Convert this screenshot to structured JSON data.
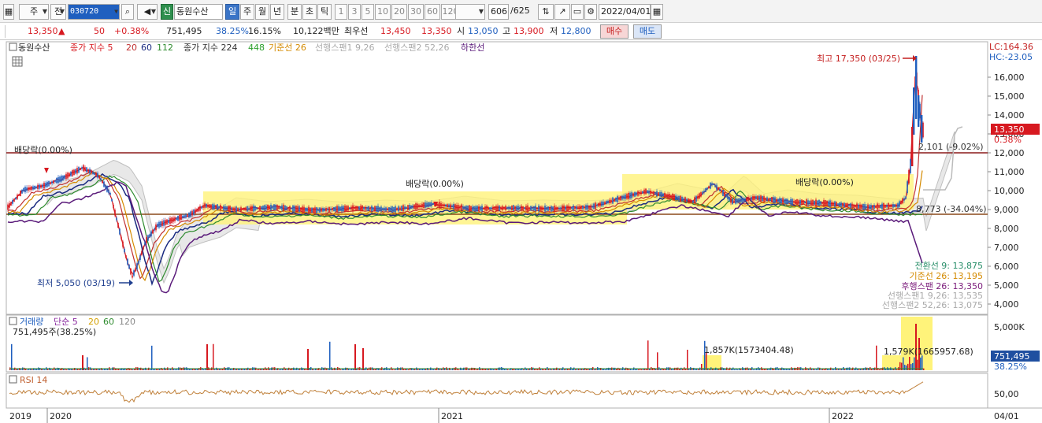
{
  "toolbar": {
    "period": "주",
    "prev": "전",
    "code": "030720",
    "sound_icon": "speaker-icon",
    "new_badge": "신",
    "stock_name": "동원수산",
    "tf_day": "일",
    "tf_week": "주",
    "tf_month": "월",
    "tf_year": "년",
    "tf_min": "분",
    "tf_sec": "초",
    "tf_tick": "틱",
    "intervals": [
      "1",
      "3",
      "5",
      "10",
      "20",
      "30",
      "60",
      "120"
    ],
    "count": "606",
    "total": "/625",
    "date": "2022/04/01"
  },
  "quote": {
    "price": "13,350",
    "arrow": "▲",
    "change": "50",
    "change_pct": "+0.38%",
    "volume": "751,495",
    "vol_ratio": "38.25%",
    "turnover": "16.15%",
    "amount": "10,122백만",
    "best_ask_label": "최우선",
    "best_ask": "13,450",
    "best_bid": "13,350",
    "open_label": "시",
    "open": "13,050",
    "high_label": "고",
    "high": "13,900",
    "low_label": "저",
    "low": "12,800",
    "buy": "매수",
    "sell": "매도"
  },
  "legend": {
    "name": "동원수산",
    "ma_label": "종가 지수 5",
    "ma20": "20",
    "ma60": "60",
    "ma112": "112",
    "ma224_label": "종가 지수 224",
    "ma448": "448",
    "base_line": "기준선 26",
    "span1": "선행스팬1 9,26",
    "span2": "선행스팬2 52,26",
    "lower": "하한선"
  },
  "annotations": {
    "high": "최고 17,350 (03/25)",
    "low": "최저 5,050 (03/19)",
    "div1": "배당락(0.00%)",
    "div2": "배당락(0.00%)",
    "div3": "배당락(0.00%)",
    "hline1": "2,101 (-9.02%)",
    "hline2": "8,773 (-34.04%)",
    "lc": "LC:164.36",
    "hc": "HC:-23.05",
    "cur_price": "13,350",
    "cur_pct": "0.38%"
  },
  "right_legend": {
    "conv": "전환선 9: 13,875",
    "base": "기준선 26: 13,195",
    "lag": "후행스팬 26: 13,350",
    "s1": "선행스팬1 9,26: 13,535",
    "s2": "선행스팬2 52,26: 13,075"
  },
  "price_axis": [
    "16,000",
    "15,000",
    "14,000",
    "13,000",
    "12,000",
    "11,000",
    "10,000",
    "9,000",
    "8,000",
    "7,000",
    "6,000",
    "5,000",
    "4,000"
  ],
  "volume_panel": {
    "label": "거래량",
    "ma_label": "단순 5",
    "ma20": "20",
    "ma60": "60",
    "ma120": "120",
    "current": "751,495주(38.25%)",
    "ann1": "1,857K(1573404.48)",
    "ann2": "1,579K(1665957.68)",
    "axis": "5,000K",
    "cur_val": "751,495",
    "cur_pct": "38.25%"
  },
  "rsi_panel": {
    "label": "RSI 14",
    "axis": "50,00"
  },
  "date_axis": [
    "2019",
    "2020",
    "2021",
    "2022",
    "04/01"
  ],
  "colors": {
    "up": "#d71920",
    "down": "#1f5fbf",
    "ma5": "#d71920",
    "ma20": "#c03030",
    "ma60": "#1a2a80",
    "ma112": "#2e8b2e",
    "base": "#d48a00",
    "lower": "#5a1a7a",
    "cloud": "#fff37a"
  }
}
